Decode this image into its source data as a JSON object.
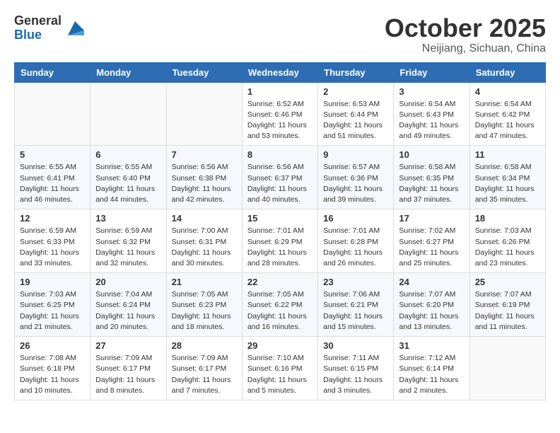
{
  "logo": {
    "general": "General",
    "blue": "Blue"
  },
  "title": "October 2025",
  "location": "Neijiang, Sichuan, China",
  "days_header": [
    "Sunday",
    "Monday",
    "Tuesday",
    "Wednesday",
    "Thursday",
    "Friday",
    "Saturday"
  ],
  "weeks": [
    [
      {
        "day": "",
        "info": ""
      },
      {
        "day": "",
        "info": ""
      },
      {
        "day": "",
        "info": ""
      },
      {
        "day": "1",
        "info": "Sunrise: 6:52 AM\nSunset: 6:46 PM\nDaylight: 11 hours\nand 53 minutes."
      },
      {
        "day": "2",
        "info": "Sunrise: 6:53 AM\nSunset: 6:44 PM\nDaylight: 11 hours\nand 51 minutes."
      },
      {
        "day": "3",
        "info": "Sunrise: 6:54 AM\nSunset: 6:43 PM\nDaylight: 11 hours\nand 49 minutes."
      },
      {
        "day": "4",
        "info": "Sunrise: 6:54 AM\nSunset: 6:42 PM\nDaylight: 11 hours\nand 47 minutes."
      }
    ],
    [
      {
        "day": "5",
        "info": "Sunrise: 6:55 AM\nSunset: 6:41 PM\nDaylight: 11 hours\nand 46 minutes."
      },
      {
        "day": "6",
        "info": "Sunrise: 6:55 AM\nSunset: 6:40 PM\nDaylight: 11 hours\nand 44 minutes."
      },
      {
        "day": "7",
        "info": "Sunrise: 6:56 AM\nSunset: 6:38 PM\nDaylight: 11 hours\nand 42 minutes."
      },
      {
        "day": "8",
        "info": "Sunrise: 6:56 AM\nSunset: 6:37 PM\nDaylight: 11 hours\nand 40 minutes."
      },
      {
        "day": "9",
        "info": "Sunrise: 6:57 AM\nSunset: 6:36 PM\nDaylight: 11 hours\nand 39 minutes."
      },
      {
        "day": "10",
        "info": "Sunrise: 6:58 AM\nSunset: 6:35 PM\nDaylight: 11 hours\nand 37 minutes."
      },
      {
        "day": "11",
        "info": "Sunrise: 6:58 AM\nSunset: 6:34 PM\nDaylight: 11 hours\nand 35 minutes."
      }
    ],
    [
      {
        "day": "12",
        "info": "Sunrise: 6:59 AM\nSunset: 6:33 PM\nDaylight: 11 hours\nand 33 minutes."
      },
      {
        "day": "13",
        "info": "Sunrise: 6:59 AM\nSunset: 6:32 PM\nDaylight: 11 hours\nand 32 minutes."
      },
      {
        "day": "14",
        "info": "Sunrise: 7:00 AM\nSunset: 6:31 PM\nDaylight: 11 hours\nand 30 minutes."
      },
      {
        "day": "15",
        "info": "Sunrise: 7:01 AM\nSunset: 6:29 PM\nDaylight: 11 hours\nand 28 minutes."
      },
      {
        "day": "16",
        "info": "Sunrise: 7:01 AM\nSunset: 6:28 PM\nDaylight: 11 hours\nand 26 minutes."
      },
      {
        "day": "17",
        "info": "Sunrise: 7:02 AM\nSunset: 6:27 PM\nDaylight: 11 hours\nand 25 minutes."
      },
      {
        "day": "18",
        "info": "Sunrise: 7:03 AM\nSunset: 6:26 PM\nDaylight: 11 hours\nand 23 minutes."
      }
    ],
    [
      {
        "day": "19",
        "info": "Sunrise: 7:03 AM\nSunset: 6:25 PM\nDaylight: 11 hours\nand 21 minutes."
      },
      {
        "day": "20",
        "info": "Sunrise: 7:04 AM\nSunset: 6:24 PM\nDaylight: 11 hours\nand 20 minutes."
      },
      {
        "day": "21",
        "info": "Sunrise: 7:05 AM\nSunset: 6:23 PM\nDaylight: 11 hours\nand 18 minutes."
      },
      {
        "day": "22",
        "info": "Sunrise: 7:05 AM\nSunset: 6:22 PM\nDaylight: 11 hours\nand 16 minutes."
      },
      {
        "day": "23",
        "info": "Sunrise: 7:06 AM\nSunset: 6:21 PM\nDaylight: 11 hours\nand 15 minutes."
      },
      {
        "day": "24",
        "info": "Sunrise: 7:07 AM\nSunset: 6:20 PM\nDaylight: 11 hours\nand 13 minutes."
      },
      {
        "day": "25",
        "info": "Sunrise: 7:07 AM\nSunset: 6:19 PM\nDaylight: 11 hours\nand 11 minutes."
      }
    ],
    [
      {
        "day": "26",
        "info": "Sunrise: 7:08 AM\nSunset: 6:18 PM\nDaylight: 11 hours\nand 10 minutes."
      },
      {
        "day": "27",
        "info": "Sunrise: 7:09 AM\nSunset: 6:17 PM\nDaylight: 11 hours\nand 8 minutes."
      },
      {
        "day": "28",
        "info": "Sunrise: 7:09 AM\nSunset: 6:17 PM\nDaylight: 11 hours\nand 7 minutes."
      },
      {
        "day": "29",
        "info": "Sunrise: 7:10 AM\nSunset: 6:16 PM\nDaylight: 11 hours\nand 5 minutes."
      },
      {
        "day": "30",
        "info": "Sunrise: 7:11 AM\nSunset: 6:15 PM\nDaylight: 11 hours\nand 3 minutes."
      },
      {
        "day": "31",
        "info": "Sunrise: 7:12 AM\nSunset: 6:14 PM\nDaylight: 11 hours\nand 2 minutes."
      },
      {
        "day": "",
        "info": ""
      }
    ]
  ]
}
